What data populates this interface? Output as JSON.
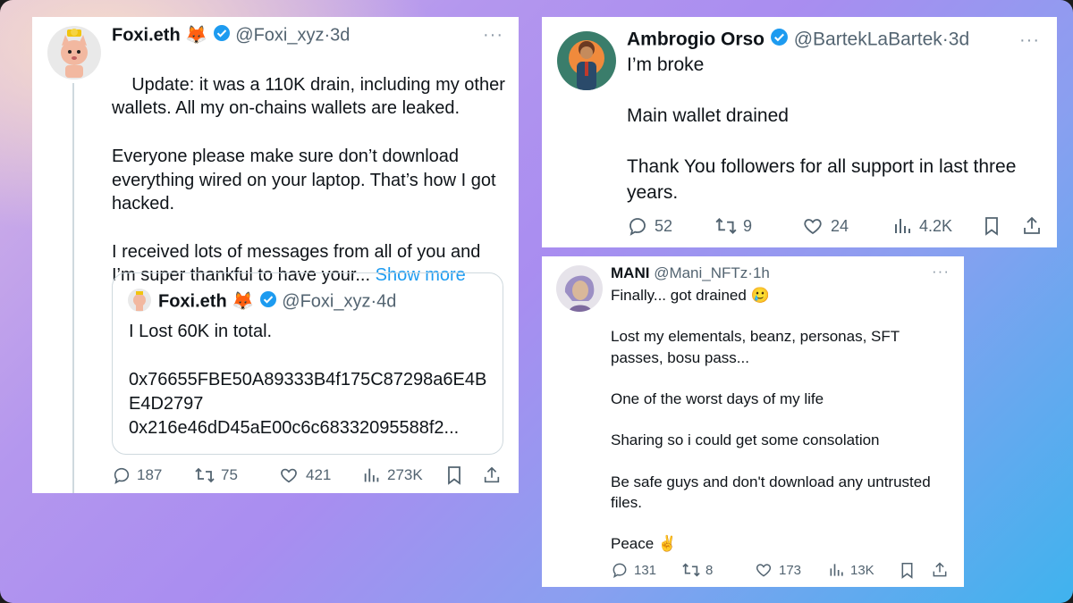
{
  "colors": {
    "accent": "#1d9bf0",
    "text": "#0f1419",
    "muted": "#536471"
  },
  "tweet1": {
    "name": "Foxi.eth",
    "emoji": "🦊",
    "handle": "@Foxi_xyz",
    "time": "3d",
    "text": "Update: it was a 110K drain, including my other wallets. All my on-chains wallets are leaked.\n\nEveryone please make sure don’t download everything wired on your laptop. That’s how I got hacked.\n\nI received lots of messages from all of you and I’m super thankful to have your...",
    "show_more": "Show more",
    "quote": {
      "name": "Foxi.eth",
      "emoji": "🦊",
      "handle": "@Foxi_xyz",
      "time": "4d",
      "text": "I Lost 60K in total.\n\n0x76655FBE50A89333B4f175C87298a6E4BE4D2797\n0x216e46dD45aE00c6c68332095588f2..."
    },
    "replies": "187",
    "retweets": "75",
    "likes": "421",
    "views": "273K"
  },
  "tweet2": {
    "name": "Ambrogio Orso",
    "handle": "@BartekLaBartek",
    "time": "3d",
    "text": "I’m broke\n\nMain wallet drained\n\nThank You followers for all support in last three years.",
    "replies": "52",
    "retweets": "9",
    "likes": "24",
    "views": "4.2K"
  },
  "tweet3": {
    "name": "MANI",
    "handle": "@Mani_NFTz",
    "time": "1h",
    "text": "Finally... got drained 🥲\n\nLost my elementals, beanz, personas, SFT passes, bosu pass...\n\nOne of the worst days of my life\n\nSharing so i could get some consolation\n\nBe safe guys and don't download any untrusted files.\n\nPeace ✌️",
    "replies": "131",
    "retweets": "8",
    "likes": "173",
    "views": "13K"
  }
}
